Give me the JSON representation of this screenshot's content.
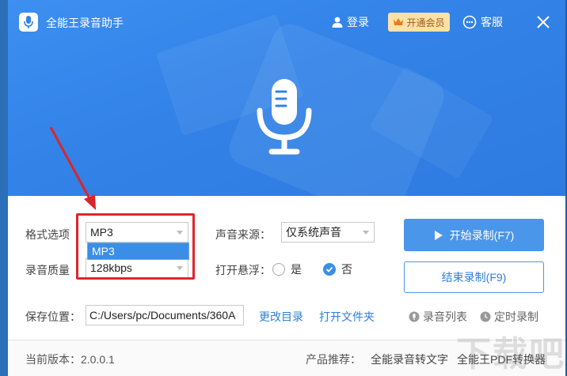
{
  "app": {
    "title": "全能王录音助手",
    "login_label": "登录",
    "vip_label": "开通会员",
    "service_label": "客服"
  },
  "settings": {
    "format_label": "格式选项",
    "format_value": "MP3",
    "format_dropdown_options": [
      "MP3"
    ],
    "quality_label": "录音质量",
    "quality_value": "128kbps",
    "source_label": "声音来源：",
    "source_value": "仅系统声音",
    "float_label": "打开悬浮：",
    "float_yes": "是",
    "float_no": "否",
    "float_selected": "否",
    "save_label": "保存位置：",
    "save_path": "C:/Users/pc/Documents/360A",
    "change_dir_label": "更改目录",
    "open_folder_label": "打开文件夹"
  },
  "actions": {
    "start_label": "开始录制(F7)",
    "stop_label": "结束录制(F9)",
    "record_list_label": "录音列表",
    "timer_label": "定时录制"
  },
  "footer": {
    "version": "当前版本：2.0.0.1",
    "recommend_label": "产品推荐：",
    "product1": "全能录音转文字",
    "product2": "全能王PDF转换器"
  },
  "watermark": "下载吧",
  "colors": {
    "header": "#3282e8",
    "accent": "#4a96ea",
    "highlight_box": "#e0262b",
    "annotation_arrow": "#d9262b",
    "vip_bg": "#fde1a6"
  },
  "icons": [
    "app-mic-icon",
    "user-icon",
    "crown-icon",
    "headset-icon",
    "close-icon",
    "microphone-icon",
    "play-icon",
    "check-icon",
    "record-list-icon",
    "clock-icon"
  ]
}
